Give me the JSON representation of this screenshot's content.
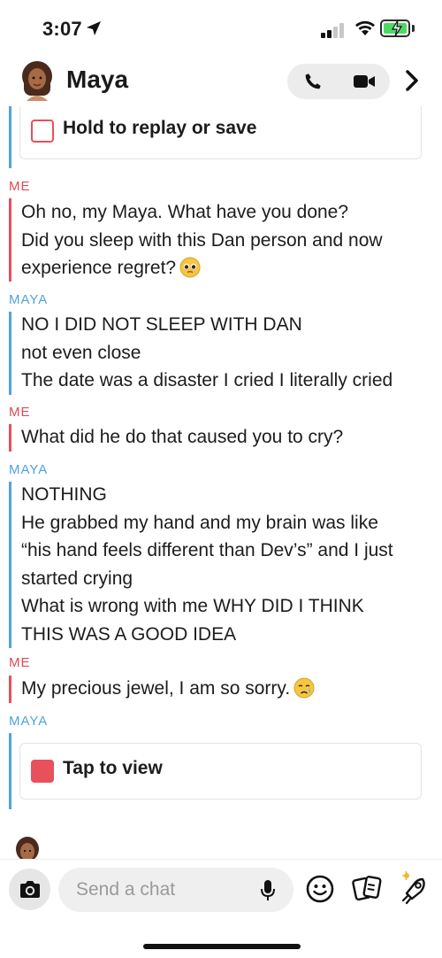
{
  "status_bar": {
    "time": "3:07"
  },
  "header": {
    "contact_name": "Maya"
  },
  "colors": {
    "me": "#e04a58",
    "maya": "#4fa3e0",
    "snap_red": "#e8505b",
    "battery_green": "#4cd964"
  },
  "chat": {
    "snap_saved_label": "Hold to replay or save",
    "snap_view_label": "Tap to view",
    "messages": [
      {
        "sender": "ME",
        "text": "Oh no, my Maya. What have you done?\nDid you sleep with this Dan person and now\nexperience regret?"
      },
      {
        "sender": "MAYA",
        "text": "NO I DID NOT SLEEP WITH DAN\nnot even close\nThe date was a disaster I cried I literally cried"
      },
      {
        "sender": "ME",
        "text": "What did he do that caused you to cry?"
      },
      {
        "sender": "MAYA",
        "text": "NOTHING\nHe grabbed my hand and my brain was like\n“his hand feels different than Dev’s” and I just\nstarted crying\nWhat is wrong with me WHY DID I THINK\nTHIS WAS A GOOD IDEA"
      },
      {
        "sender": "ME",
        "text": "My precious jewel, I am so sorry."
      },
      {
        "sender": "MAYA",
        "text": ""
      }
    ]
  },
  "input": {
    "placeholder": "Send a chat"
  },
  "icons": [
    "location-arrow-icon",
    "signal-icon",
    "wifi-icon",
    "battery-charging-icon",
    "phone-icon",
    "video-camera-icon",
    "chevron-right-icon",
    "camera-icon",
    "microphone-icon",
    "smiley-icon",
    "cards-icon",
    "rocket-icon"
  ]
}
